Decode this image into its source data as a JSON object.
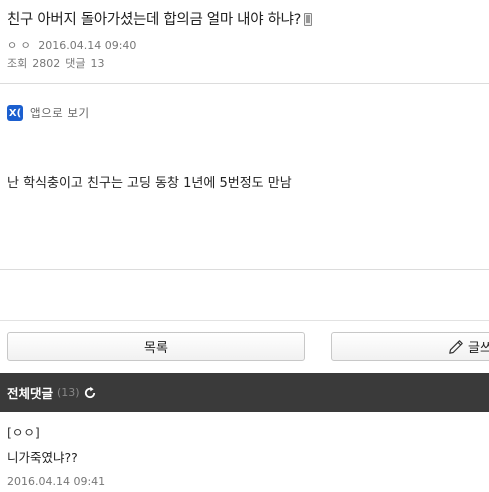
{
  "post": {
    "title": "친구 아버지 돌아가셨는데 합의금 얼마 내야 하냐?",
    "title_icon": "mobile-phone-icon",
    "author": "ㅇ ㅇ",
    "date": "2016.04.14 09:40",
    "views_label": "조회",
    "views": "2802",
    "comments_label": "댓글",
    "comments": "13"
  },
  "app_view": {
    "icon_text": "X(",
    "label": "앱으로 보기"
  },
  "content": {
    "text": "난 학식충이고 친구는 고딩 동창 1년에 5번정도 만남"
  },
  "buttons": {
    "list_label": "목록",
    "write_label": "글쓰"
  },
  "comments_section": {
    "title": "전체댓글",
    "count": "(13)",
    "items": [
      {
        "author": "[ㅇㅇ]",
        "text": "니가죽였냐??",
        "date": "2016.04.14 09:41"
      }
    ]
  },
  "colors": {
    "comment_bar": "#3a3a3a",
    "app_icon": "#1b5fcf"
  }
}
